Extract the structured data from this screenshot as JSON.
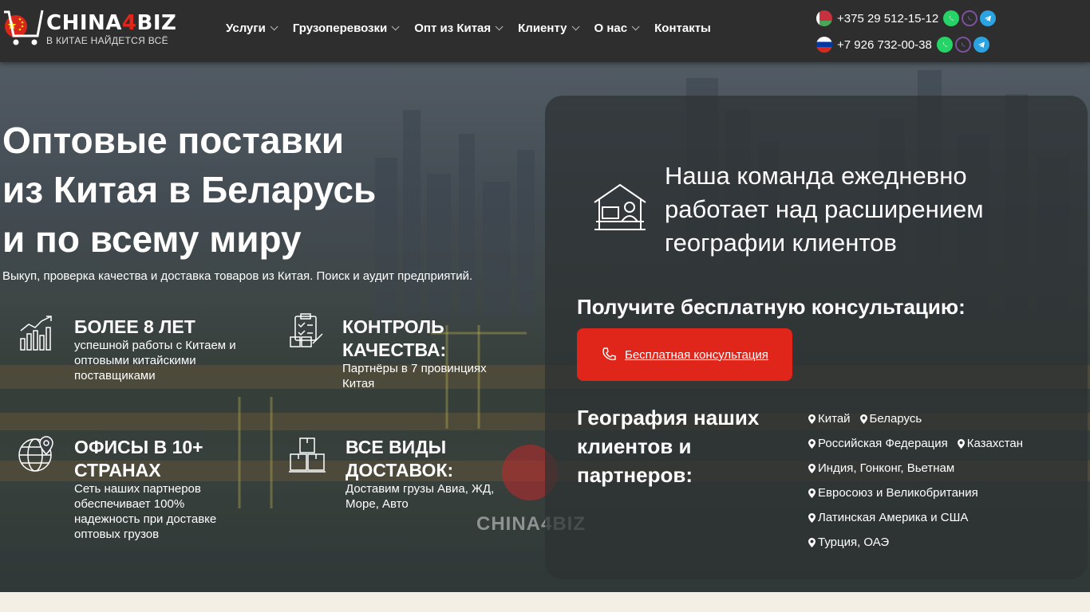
{
  "header": {
    "logo": {
      "name_a": "CHINA",
      "name_b": "4",
      "name_c": "BIZ",
      "tagline": "В КИТАЕ НАЙДЕТСЯ ВСЁ"
    },
    "nav": [
      {
        "label": "Услуги",
        "has_dropdown": true
      },
      {
        "label": "Грузоперевозки",
        "has_dropdown": true
      },
      {
        "label": "Опт из Китая",
        "has_dropdown": true
      },
      {
        "label": "Клиенту",
        "has_dropdown": true
      },
      {
        "label": "О нас",
        "has_dropdown": true
      },
      {
        "label": "Контакты",
        "has_dropdown": false
      }
    ],
    "phones": [
      {
        "flag": "belarus-flag-icon",
        "number": "+375 29 512-15-12"
      },
      {
        "flag": "russia-flag-icon",
        "number": "+7 926 732-00-38"
      }
    ],
    "messengers": [
      "whatsapp-icon",
      "viber-icon",
      "telegram-icon"
    ]
  },
  "hero": {
    "title_lines": [
      "Оптовые поставки",
      "из Китая в Беларусь",
      "и по всему миру"
    ],
    "subtitle": "Выкуп, проверка качества и доставка товаров из Китая. Поиск и аудит предприятий.",
    "watermark": "CHINA4BIZ",
    "features": [
      {
        "icon": "growth-chart-icon",
        "title": "БОЛЕЕ 8 ЛЕТ",
        "text": "успешной работы с Китаем и оптовыми китайскими поставщиками"
      },
      {
        "icon": "quality-checklist-icon",
        "title": "КОНТРОЛЬ КАЧЕСТВА:",
        "text": "Партнёры в 7 провинциях Китая"
      },
      {
        "icon": "globe-pin-icon",
        "title": "ОФИСЫ В 10+ СТРАНАХ",
        "text": "Сеть наших партнеров обеспечивает 100% надежность при доставке оптовых грузов"
      },
      {
        "icon": "boxes-icon",
        "title": "ВСЕ ВИДЫ ДОСТАВОК:",
        "text": "Доставим грузы Авиа, ЖД, Море, Авто"
      }
    ]
  },
  "panel": {
    "team_icon": "support-desk-icon",
    "team_text": "Наша команда ежедневно работает над расширением географии клиентов",
    "consult_heading": "Получите бесплатную консультацию:",
    "consult_button": "Бесплатная консультация",
    "geo_heading": "География наших клиентов и партнеров:",
    "geo_rows": [
      [
        "Китай",
        "Беларусь"
      ],
      [
        "Российская Федерация",
        "Казахстан"
      ],
      [
        "Индия, Гонконг, Вьетнам"
      ],
      [
        "Евросоюз и Великобритания"
      ],
      [
        "Латинская Америка и США"
      ],
      [
        "Турция, ОАЭ"
      ]
    ]
  },
  "colors": {
    "accent": "#e0251b",
    "header_bg": "#2e2e2e",
    "panel_bg": "#2d3032"
  }
}
